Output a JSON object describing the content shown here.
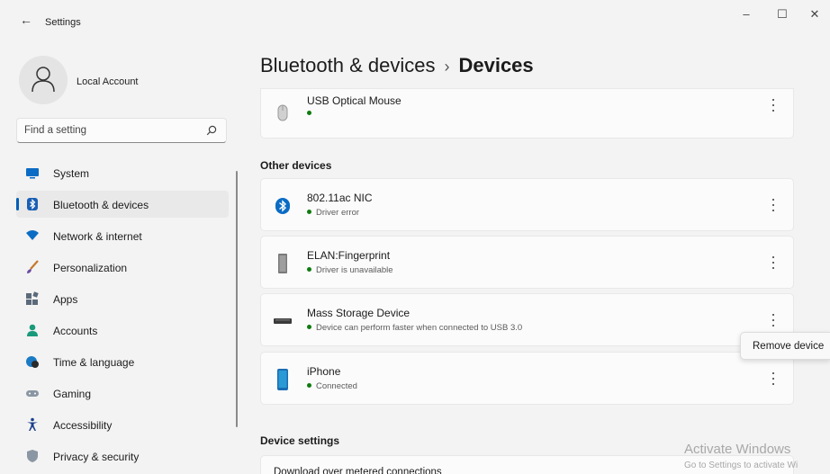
{
  "window": {
    "title": "Settings",
    "back_glyph": "←",
    "minimize_glyph": "–",
    "maximize_glyph": "☐",
    "close_glyph": "✕"
  },
  "account": {
    "name": "Local Account",
    "icon": "person-icon"
  },
  "search": {
    "placeholder": "Find a setting",
    "icon": "search-icon"
  },
  "nav": {
    "items": [
      {
        "label": "System",
        "icon": "system-icon",
        "active": false
      },
      {
        "label": "Bluetooth & devices",
        "icon": "bluetooth-icon",
        "active": true
      },
      {
        "label": "Network & internet",
        "icon": "wifi-icon",
        "active": false
      },
      {
        "label": "Personalization",
        "icon": "brush-icon",
        "active": false
      },
      {
        "label": "Apps",
        "icon": "apps-icon",
        "active": false
      },
      {
        "label": "Accounts",
        "icon": "accounts-icon",
        "active": false
      },
      {
        "label": "Time & language",
        "icon": "globe-clock-icon",
        "active": false
      },
      {
        "label": "Gaming",
        "icon": "gamepad-icon",
        "active": false
      },
      {
        "label": "Accessibility",
        "icon": "accessibility-icon",
        "active": false
      },
      {
        "label": "Privacy & security",
        "icon": "shield-icon",
        "active": false
      }
    ]
  },
  "breadcrumb": {
    "parent": "Bluetooth & devices",
    "separator": "›",
    "current": "Devices"
  },
  "devices": {
    "mouse": {
      "name": "USB Optical Mouse",
      "status": "",
      "icon": "mouse-icon"
    },
    "other_title": "Other devices",
    "other": [
      {
        "name": "802.11ac NIC",
        "status": "Driver error",
        "icon": "bluetooth-device-icon"
      },
      {
        "name": "ELAN:Fingerprint",
        "status": "Driver is unavailable",
        "icon": "fingerprint-device-icon"
      },
      {
        "name": "Mass Storage Device",
        "status": "Device can perform faster when connected to USB 3.0",
        "icon": "usb-drive-icon"
      },
      {
        "name": "iPhone",
        "status": "Connected",
        "icon": "phone-icon"
      }
    ]
  },
  "device_settings": {
    "title": "Device settings",
    "row_label": "Download over metered connections"
  },
  "context_menu": {
    "item": "Remove device"
  },
  "watermark": {
    "line1": "Activate Windows",
    "line2": "Go to Settings to activate Wi"
  },
  "colors": {
    "accent": "#005fb8",
    "status_ok": "#0f7b0f"
  }
}
